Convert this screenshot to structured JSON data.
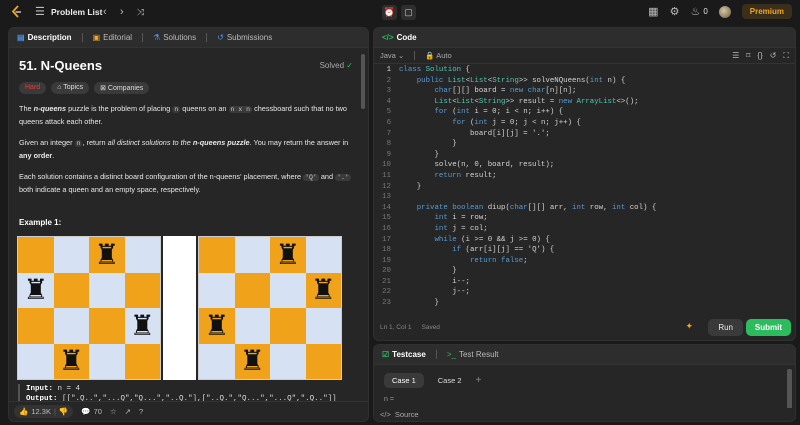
{
  "topbar": {
    "problem_list": "Problem List",
    "streak": "0",
    "premium": "Premium"
  },
  "left_tabs": [
    "Description",
    "Editorial",
    "Solutions",
    "Submissions"
  ],
  "problem": {
    "title": "51. N-Queens",
    "solved": "Solved",
    "difficulty": "Hard",
    "tags": [
      "Topics",
      "Companies"
    ],
    "p1_a": "The ",
    "p1_b": "n-queens",
    "p1_c": " puzzle is the problem of placing ",
    "p1_n": "n",
    "p1_d": " queens on an ",
    "p1_nxn": "n x n",
    "p1_e": " chessboard such that no two queens attack each other.",
    "p2_a": "Given an integer ",
    "p2_n": "n",
    "p2_b": ", return ",
    "p2_c": "all distinct solutions to the ",
    "p2_d": "n-queens puzzle",
    "p2_e": ". You may return the answer in ",
    "p2_f": "any order",
    "p2_g": ".",
    "p3_a": "Each solution contains a distinct board configuration of the n-queens' placement, where ",
    "p3_q": "'Q'",
    "p3_b": " and ",
    "p3_dot": "'.'",
    "p3_c": " both indicate a queen and an empty space, respectively.",
    "example_title": "Example 1:",
    "input_label": "Input:",
    "input_value": "n = 4",
    "output_label": "Output:",
    "output_value": "[[\".Q..\",\"...Q\",\"Q...\",\"..Q.\"],[\"..Q.\",\"Q...\",\"...Q\",\".Q..\"]]"
  },
  "footer": {
    "likes": "12.3K",
    "comments": "70"
  },
  "code_panel": {
    "title": "Code",
    "language": "Java",
    "auto": "Auto",
    "status": "Ln 1, Col 1",
    "saved": "Saved",
    "run": "Run",
    "submit": "Submit"
  },
  "code_lines": [
    "class Solution {",
    "    public List<List<String>> solveNQueens(int n) {",
    "        char[][] board = new char[n][n];",
    "        List<List<String>> result = new ArrayList<>();",
    "        for (int i = 0; i < n; i++) {",
    "            for (int j = 0; j < n; j++) {",
    "                board[i][j] = '.';",
    "            }",
    "        }",
    "        solve(n, 0, board, result);",
    "        return result;",
    "    }",
    "",
    "    private boolean diup(char[][] arr, int row, int col) {",
    "        int i = row;",
    "        int j = col;",
    "        while (i >= 0 && j >= 0) {",
    "            if (arr[i][j] == 'Q') {",
    "                return false;",
    "            }",
    "            i--;",
    "            j--;",
    "        }"
  ],
  "test_panel": {
    "testcase": "Testcase",
    "test_result": "Test Result",
    "cases": [
      "Case 1",
      "Case 2"
    ],
    "n_label": "n =",
    "source": "Source"
  },
  "boards": [
    [
      "..Q.",
      "Q...",
      "...Q",
      ".Q.."
    ],
    [
      "..Q.",
      "...Q",
      "Q...",
      ".Q.."
    ]
  ]
}
